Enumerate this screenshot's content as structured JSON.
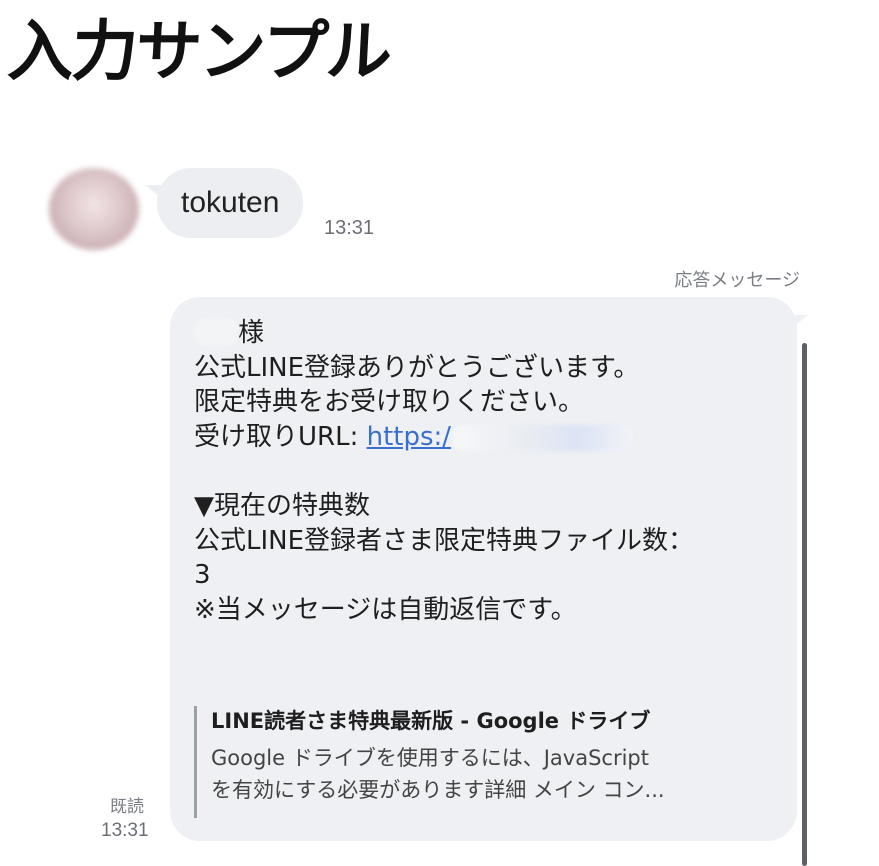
{
  "page": {
    "title": "入力サンプル"
  },
  "incoming": {
    "text": "tokuten",
    "time": "13:31"
  },
  "reply": {
    "label": "応答メッセージ",
    "lines": [
      "様",
      "公式LINE登録ありがとうございます。",
      "限定特典をお受け取りください。",
      "受け取りURL: ",
      "https:/",
      "▼現在の特典数",
      "公式LINE登録者さま限定特典ファイル数：",
      "3",
      "※当メッセージは自動返信です。"
    ],
    "preview": {
      "title": "LINE読者さま特典最新版 - Google ドライブ",
      "description_line1": "Google ドライブを使用するには、JavaScript",
      "description_line2": "を有効にする必要があります詳細 メイン コン..."
    },
    "read_status": "既読",
    "time": "13:31"
  },
  "colors": {
    "bubble": "#eef0f3",
    "link": "#3a6fd0",
    "meta_text": "#7a7e84"
  }
}
